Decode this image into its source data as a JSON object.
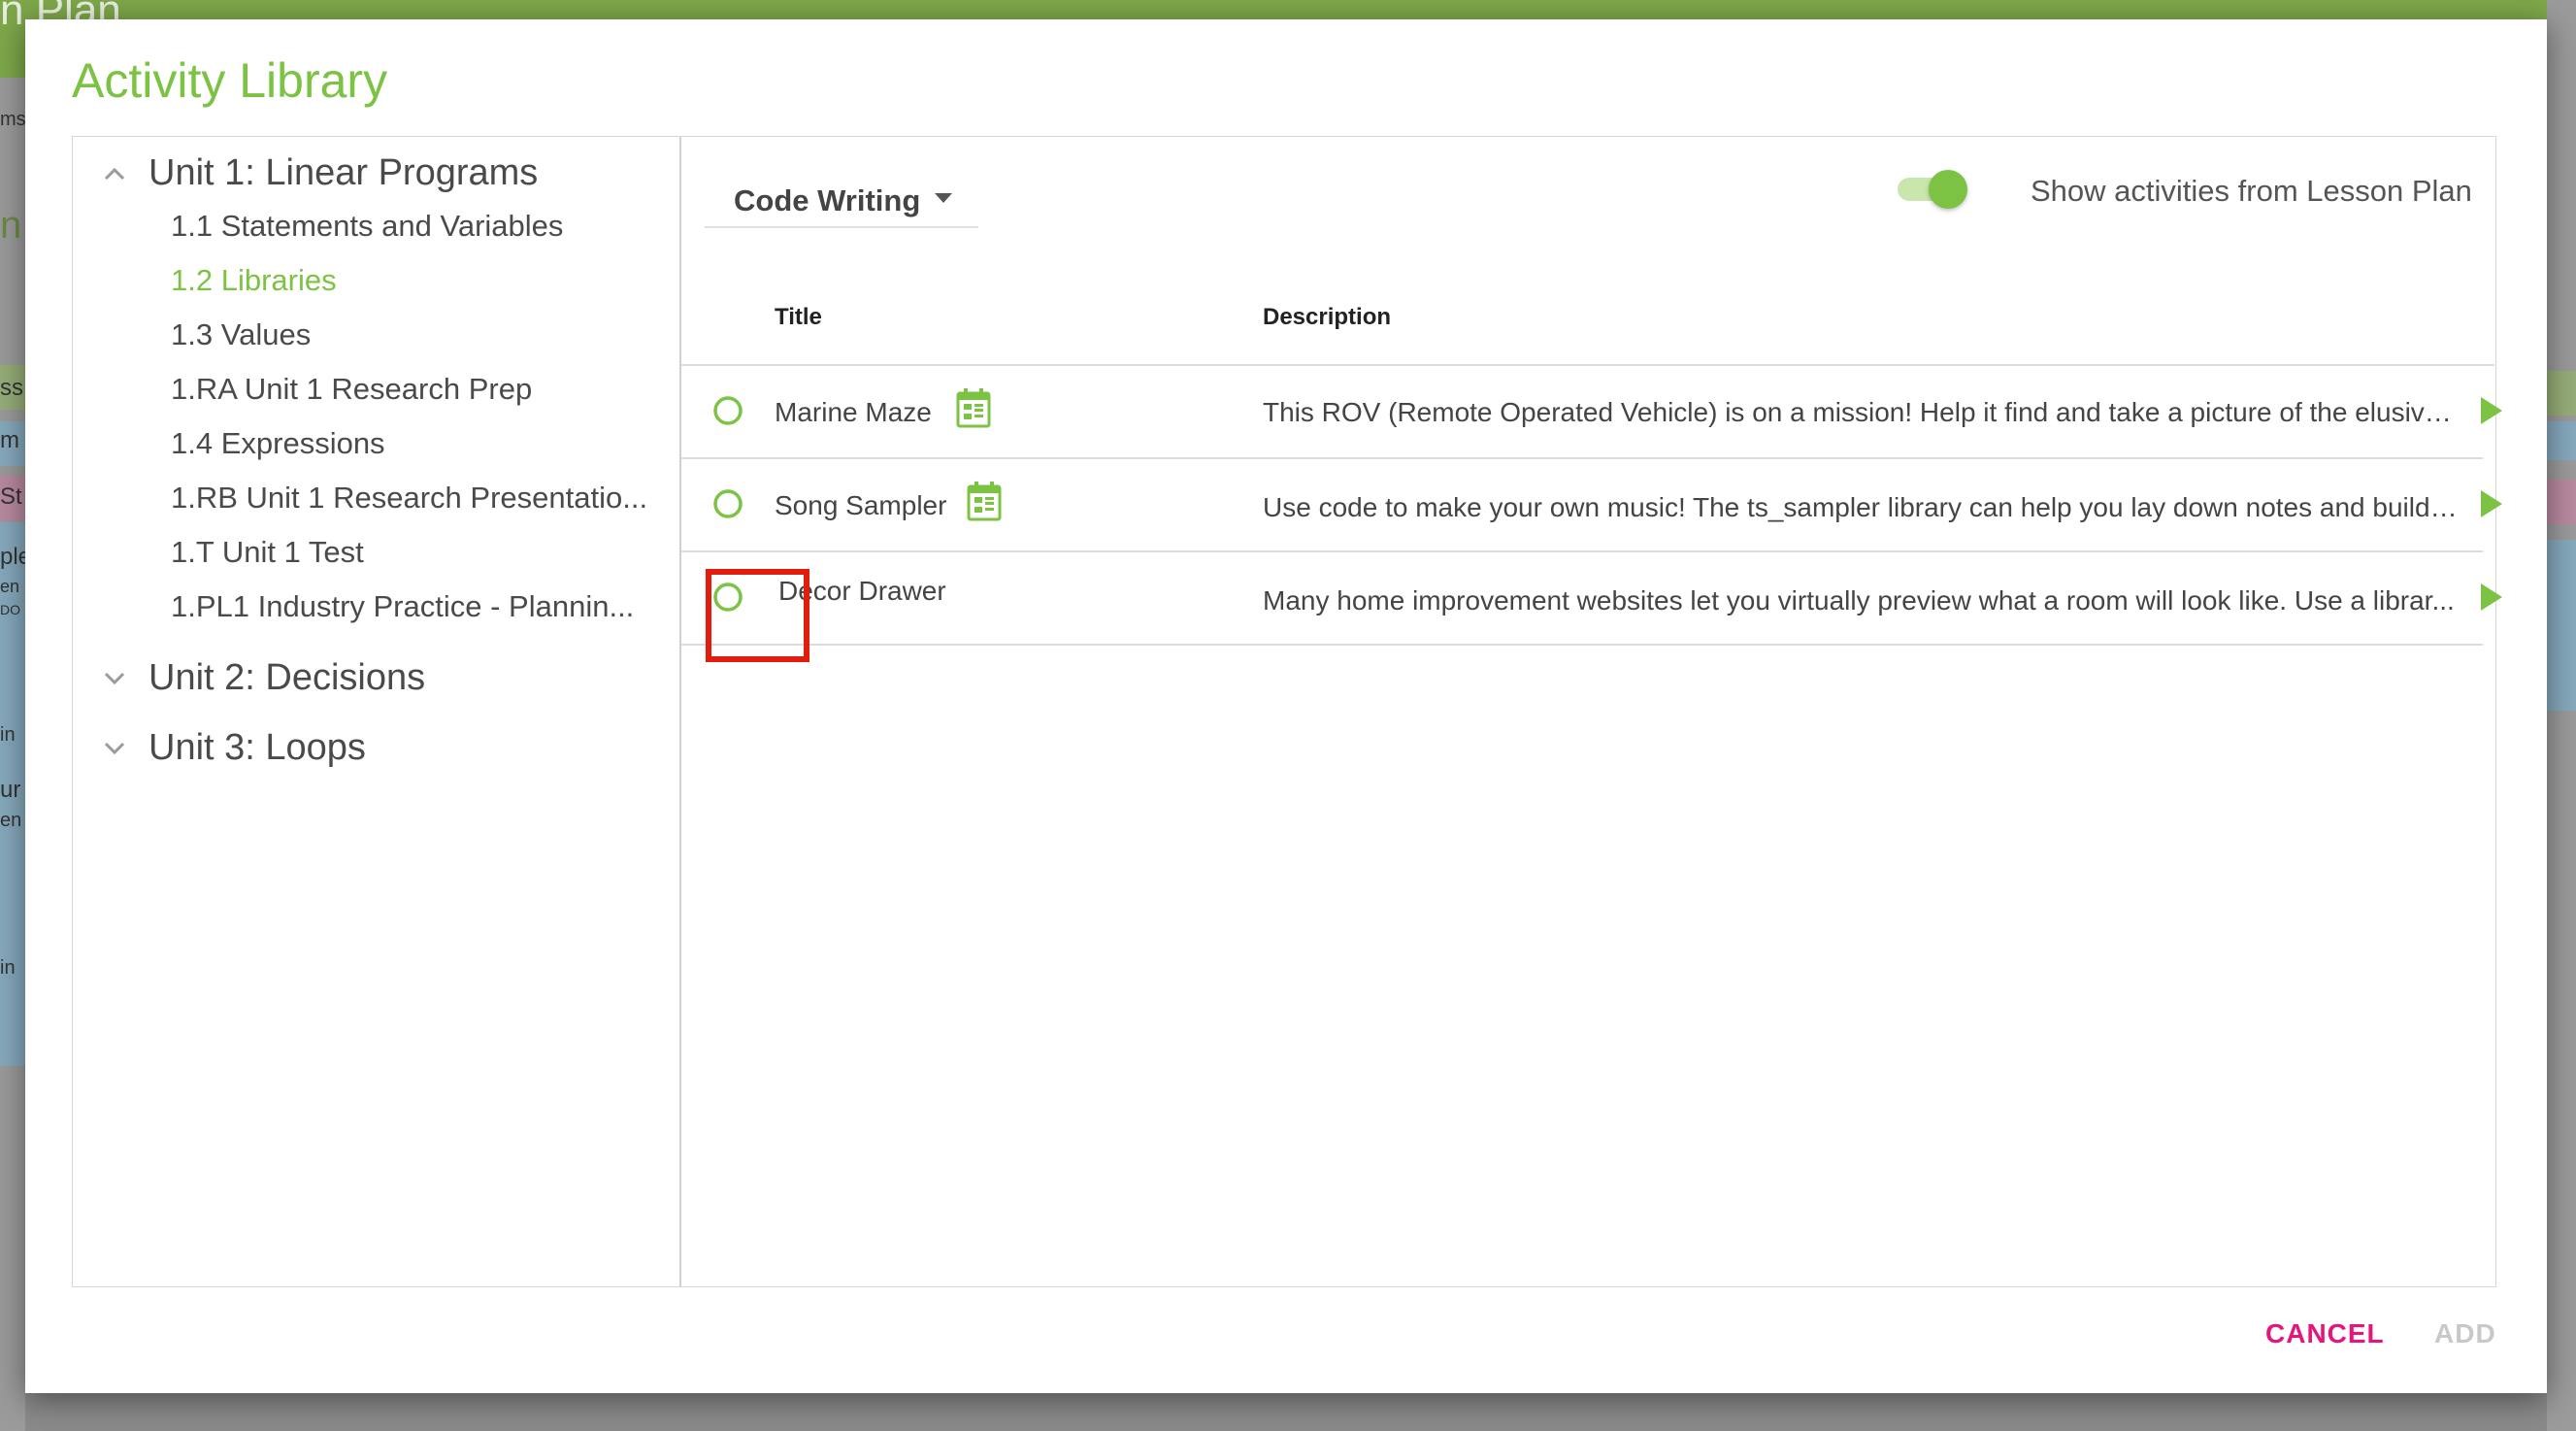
{
  "background": {
    "app_title_fragment": "n Plan",
    "left_fragments": [
      "ms",
      "n",
      "ss",
      "m",
      "St",
      "ple",
      "en",
      "DO",
      "in",
      "ur",
      "en",
      "in"
    ]
  },
  "modal": {
    "title": "Activity Library"
  },
  "sidebar": {
    "units": [
      {
        "label": "Unit 1: Linear Programs",
        "expanded": true,
        "lessons": [
          {
            "label": "1.1 Statements and Variables",
            "active": false
          },
          {
            "label": "1.2 Libraries",
            "active": true
          },
          {
            "label": "1.3 Values",
            "active": false
          },
          {
            "label": "1.RA Unit 1 Research Prep",
            "active": false
          },
          {
            "label": "1.4 Expressions",
            "active": false
          },
          {
            "label": "1.RB Unit 1 Research Presentatio...",
            "active": false
          },
          {
            "label": "1.T Unit 1 Test",
            "active": false
          },
          {
            "label": "1.PL1 Industry Practice - Plannin...",
            "active": false
          }
        ]
      },
      {
        "label": "Unit 2: Decisions",
        "expanded": false
      },
      {
        "label": "Unit 3: Loops",
        "expanded": false
      }
    ]
  },
  "filter": {
    "category": "Code Writing",
    "toggle_label": "Show activities from Lesson Plan",
    "toggle_on": true
  },
  "table": {
    "headers": {
      "title": "Title",
      "description": "Description"
    },
    "rows": [
      {
        "title": "Marine Maze",
        "has_calendar_icon": true,
        "description": "This ROV (Remote Operated Vehicle) is on a mission! Help it find and take a picture of the elusive ..."
      },
      {
        "title": "Song Sampler",
        "has_calendar_icon": true,
        "description": "Use code to make your own music! The ts_sampler library can help you lay down notes and build a..."
      },
      {
        "title": "Decor Drawer",
        "has_calendar_icon": false,
        "description": "Many home improvement websites let you virtually preview what a room will look like. Use a librar..."
      }
    ]
  },
  "actions": {
    "cancel": "CANCEL",
    "add": "ADD"
  },
  "colors": {
    "accent_green": "#7cc243",
    "cancel_pink": "#e5157b",
    "highlight_red": "#e11d0e",
    "disabled_gray": "#c8c8c8"
  }
}
